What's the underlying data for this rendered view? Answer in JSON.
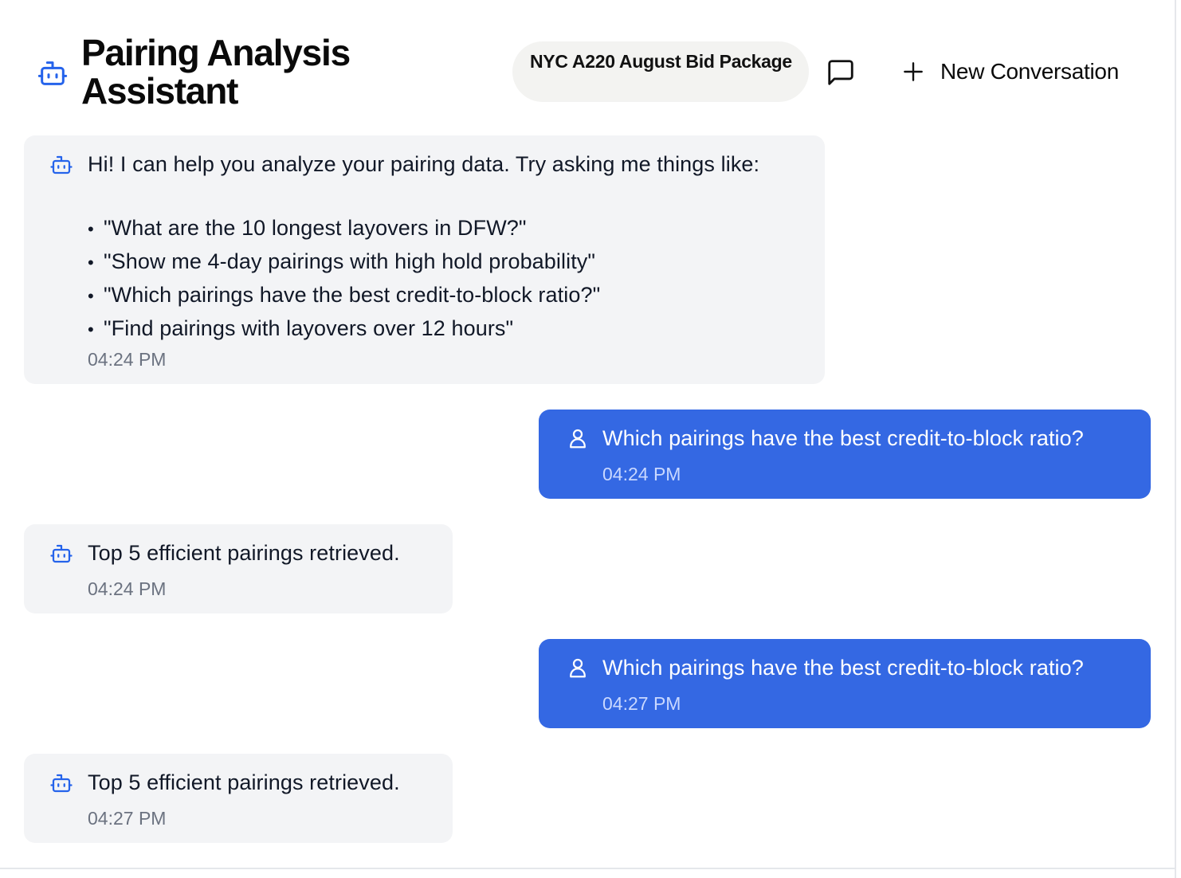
{
  "header": {
    "title": "Pairing Analysis Assistant",
    "package": "NYC A220 August Bid Package",
    "new_conversation_label": "New Conversation"
  },
  "intro": {
    "text": "Hi! I can help you analyze your pairing data. Try asking me things like:",
    "examples": [
      "\"What are the 10 longest layovers in DFW?\"",
      "\"Show me 4-day pairings with high hold probability\"",
      "\"Which pairings have the best credit-to-block ratio?\"",
      "\"Find pairings with layovers over 12 hours\""
    ],
    "time": "04:24 PM"
  },
  "messages": [
    {
      "role": "user",
      "text": "Which pairings have the best credit-to-block ratio?",
      "time": "04:24 PM"
    },
    {
      "role": "assistant",
      "text": "Top 5 efficient pairings retrieved.",
      "time": "04:24 PM"
    },
    {
      "role": "user",
      "text": "Which pairings have the best credit-to-block ratio?",
      "time": "04:27 PM"
    },
    {
      "role": "assistant",
      "text": "Top 5 efficient pairings retrieved.",
      "time": "04:27 PM"
    }
  ],
  "icons": {
    "assistant": "bot-icon",
    "user": "user-icon",
    "chat": "chat-bubble-icon",
    "new": "plus-icon"
  },
  "colors": {
    "accent": "#3468e3",
    "bot_bubble": "#f3f4f6",
    "pill": "#f3f3f1"
  }
}
